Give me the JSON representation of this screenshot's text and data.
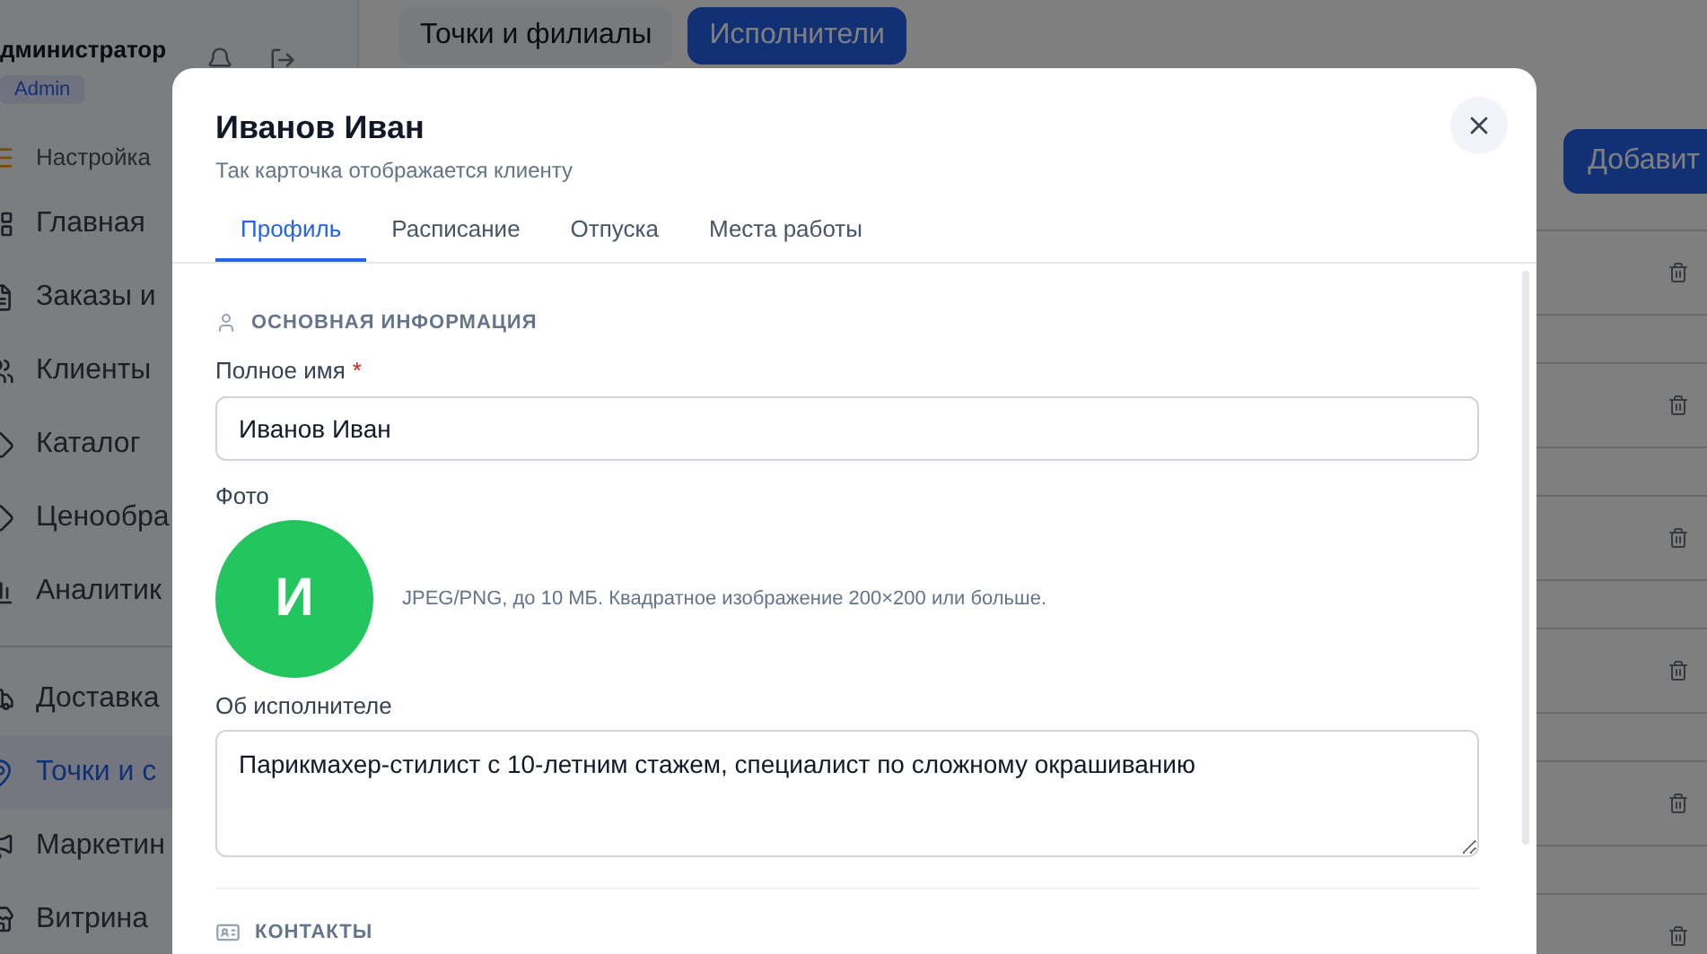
{
  "sidebar": {
    "user_name": "дминистратор",
    "role": "Admin",
    "sections": [
      {
        "items": [
          {
            "label": "Настройка",
            "kind": "setup",
            "selected": false
          },
          {
            "label": "Главная",
            "kind": "link",
            "selected": false
          },
          {
            "label": "Заказы и",
            "kind": "link",
            "selected": false
          },
          {
            "label": "Клиенты",
            "kind": "link",
            "selected": false
          },
          {
            "label": "Каталог",
            "kind": "link",
            "selected": false
          },
          {
            "label": "Ценообра",
            "kind": "link",
            "selected": false
          },
          {
            "label": "Аналитик",
            "kind": "link",
            "selected": false
          }
        ]
      },
      {
        "items": [
          {
            "label": "Доставка",
            "kind": "link",
            "selected": false
          },
          {
            "label": "Точки и с",
            "kind": "link",
            "selected": true
          },
          {
            "label": "Маркетин",
            "kind": "link",
            "selected": false
          },
          {
            "label": "Витрина",
            "kind": "link",
            "selected": false
          }
        ]
      }
    ]
  },
  "page": {
    "tabs": [
      {
        "label": "Точки и филиалы",
        "selected": false
      },
      {
        "label": "Исполнители",
        "selected": true
      }
    ],
    "add_button": "Добавит"
  },
  "dialog": {
    "title": "Иванов Иван",
    "subtitle": "Так карточка отображается клиенту",
    "tabs": [
      {
        "label": "Профиль",
        "selected": true
      },
      {
        "label": "Расписание",
        "selected": false
      },
      {
        "label": "Отпуска",
        "selected": false
      },
      {
        "label": "Места работы",
        "selected": false
      }
    ],
    "basic_section": "ОСНОВНАЯ ИНФОРМАЦИЯ",
    "full_name": {
      "label": "Полное имя",
      "required_mark": "*",
      "value": "Иванов Иван"
    },
    "photo": {
      "label": "Фото",
      "initial": "И",
      "hint": "JPEG/PNG, до 10 МБ. Квадратное изображение 200×200 или больше."
    },
    "about": {
      "label": "Об исполнителе",
      "value": "Парикмахер-стилист с 10-летним стажем, специалист по сложному окрашиванию"
    },
    "contacts_section": "КОНТАКТЫ"
  }
}
